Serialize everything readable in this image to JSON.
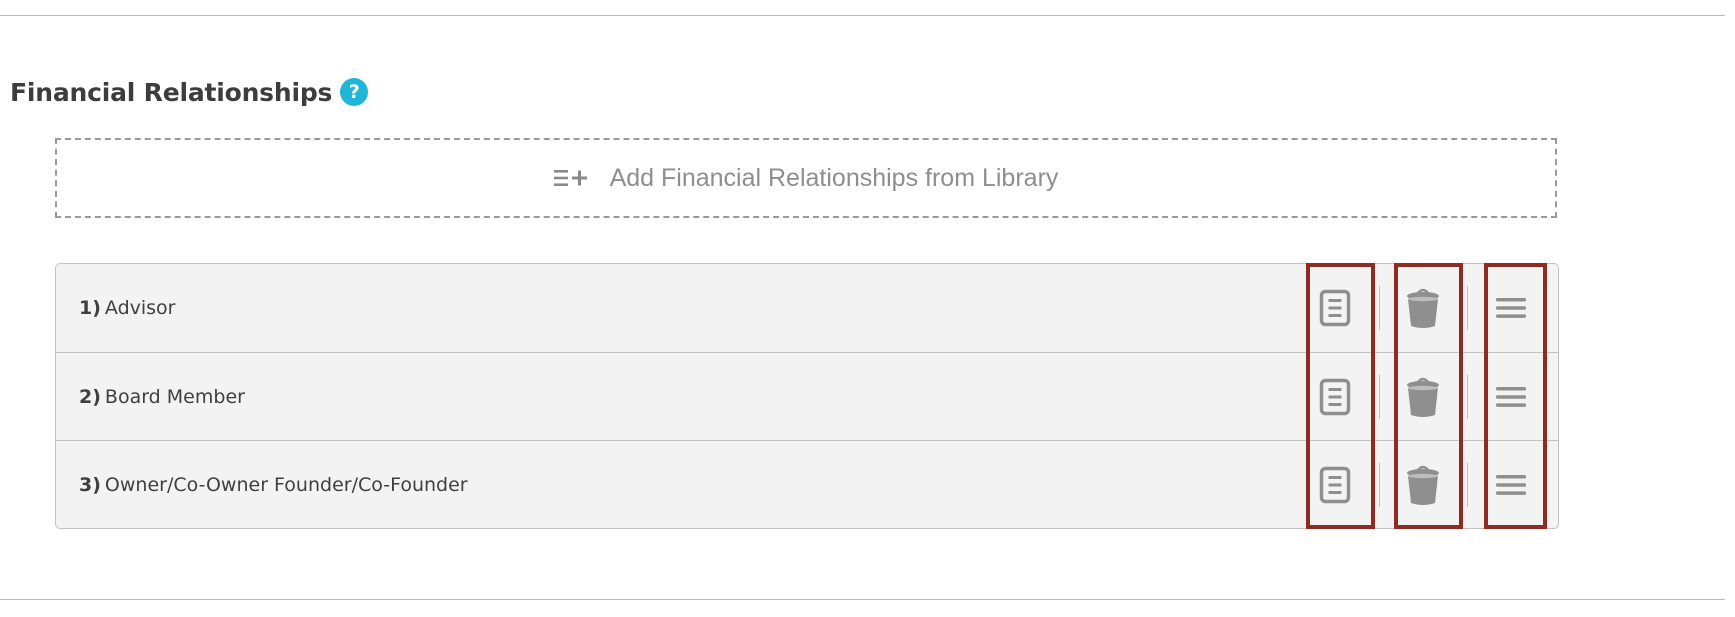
{
  "section": {
    "title": "Financial Relationships",
    "help_icon": "question-mark-icon",
    "help_glyph": "?"
  },
  "add_library": {
    "label": "Add Financial Relationships from Library",
    "icon": "list-add-icon"
  },
  "relationships": [
    {
      "number": "1)",
      "label": "Advisor"
    },
    {
      "number": "2)",
      "label": "Board Member"
    },
    {
      "number": "3)",
      "label": "Owner/Co-Owner Founder/Co-Founder"
    }
  ],
  "row_actions": {
    "edit_icon": "document-icon",
    "delete_icon": "trash-icon",
    "reorder_icon": "drag-handle-icon"
  },
  "colors": {
    "accent": "#1fb6d8",
    "highlight_border": "#8e2c23",
    "icon_gray": "#8f8f8f",
    "row_background": "#f4f3f3"
  }
}
